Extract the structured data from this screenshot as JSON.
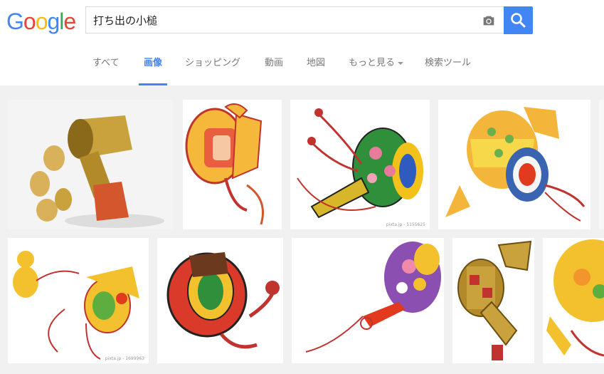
{
  "logo": {
    "letters": [
      "G",
      "o",
      "o",
      "g",
      "l",
      "e"
    ],
    "colors": [
      "#4285f4",
      "#ea4335",
      "#fbbc05",
      "#4285f4",
      "#34a853",
      "#ea4335"
    ]
  },
  "search": {
    "query": "打ち出の小槌"
  },
  "tabs": [
    {
      "label": "すべて"
    },
    {
      "label": "画像"
    },
    {
      "label": "ショッピング"
    },
    {
      "label": "動画"
    },
    {
      "label": "地図"
    },
    {
      "label": "もっと見る"
    },
    {
      "label": "検索ツール"
    }
  ],
  "results": [
    {
      "watermark": ""
    },
    {
      "watermark": ""
    },
    {
      "watermark": "pixta.jp - 5155625"
    },
    {
      "watermark": ""
    },
    {
      "watermark": ""
    },
    {
      "watermark": "pixta.jp - 1699963"
    },
    {
      "watermark": ""
    },
    {
      "watermark": ""
    },
    {
      "watermark": ""
    },
    {
      "watermark": ""
    }
  ],
  "colors": {
    "accent": "#4285f4"
  }
}
